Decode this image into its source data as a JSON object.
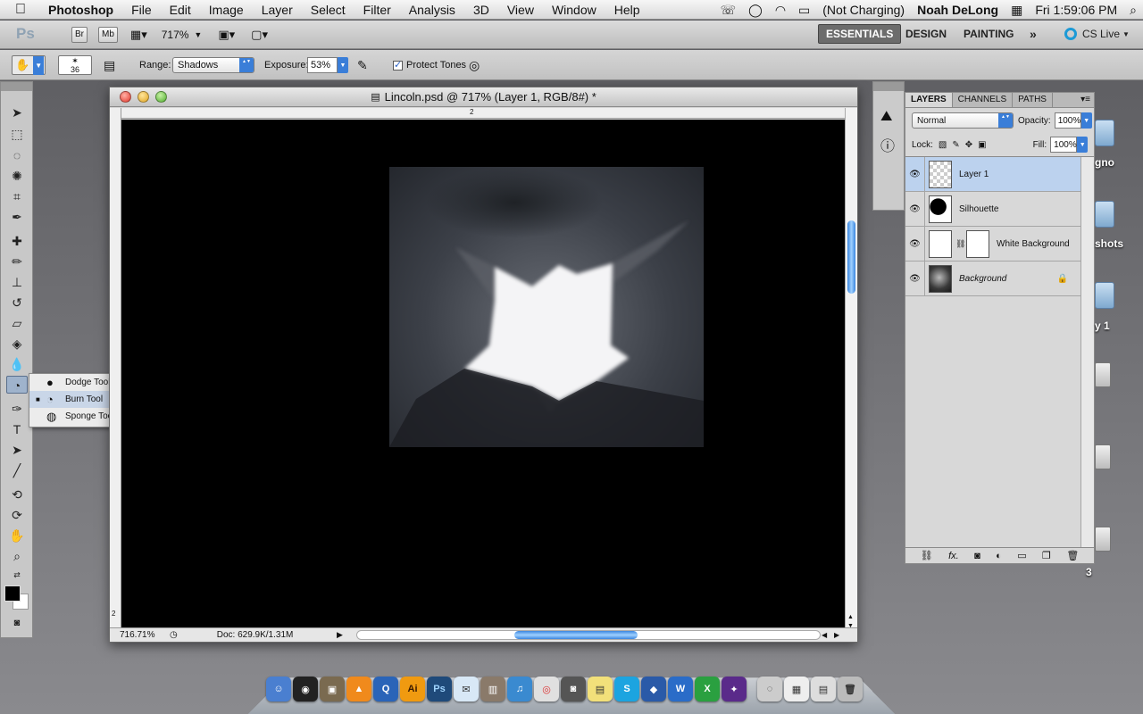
{
  "menubar": {
    "apple": "",
    "app_name": "Photoshop",
    "menus": [
      "File",
      "Edit",
      "Image",
      "Layer",
      "Select",
      "Filter",
      "Analysis",
      "3D",
      "View",
      "Window",
      "Help"
    ],
    "battery": "(Not Charging)",
    "user": "Noah DeLong",
    "clock": "Fri 1:59:06 PM"
  },
  "appbar": {
    "logo": "Ps",
    "bridge_label": "Br",
    "minibridge_label": "Mb",
    "zoom": "717%",
    "workspaces": [
      "ESSENTIALS",
      "DESIGN",
      "PAINTING"
    ],
    "active_workspace": "ESSENTIALS",
    "more": "»",
    "cs_live": "CS Live"
  },
  "options": {
    "brush_size": "36",
    "range_label": "Range:",
    "range_value": "Shadows",
    "exposure_label": "Exposure:",
    "exposure_value": "53%",
    "protect_tones_label": "Protect Tones",
    "protect_tones_checked": true
  },
  "flyout": {
    "items": [
      {
        "label": "Dodge Tool",
        "key": "O",
        "selected": false
      },
      {
        "label": "Burn Tool",
        "key": "O",
        "selected": true
      },
      {
        "label": "Sponge Tool",
        "key": "O",
        "selected": false
      }
    ]
  },
  "document": {
    "title": "Lincoln.psd @ 717% (Layer 1, RGB/8#) *",
    "ruler_top_mark": "2",
    "ruler_left_mark": "2",
    "zoom_status": "716.71%",
    "doc_info": "Doc: 629.9K/1.31M"
  },
  "layers_panel": {
    "tabs": [
      "LAYERS",
      "CHANNELS",
      "PATHS"
    ],
    "blend_mode": "Normal",
    "opacity_label": "Opacity:",
    "opacity": "100%",
    "lock_label": "Lock:",
    "fill_label": "Fill:",
    "fill": "100%",
    "layers": [
      {
        "name": "Layer 1",
        "selected": true
      },
      {
        "name": "Silhouette",
        "selected": false
      },
      {
        "name": "White Background",
        "selected": false
      },
      {
        "name": "Background",
        "selected": false
      }
    ]
  },
  "desktop_labels": [
    "gno",
    "shots",
    "y 1",
    "3"
  ],
  "dock": {
    "items": [
      "Finder",
      "Dashboard",
      "iPhoto",
      "VLC",
      "QuickTime",
      "Ai",
      "Ps",
      "Mail",
      "Preview",
      "iTunes",
      "Chrome",
      "Photo Booth",
      "Stickies",
      "Skype",
      "Maps",
      "W",
      "X",
      "Space",
      "Disk",
      "Calendar",
      "Files",
      "Trash"
    ]
  },
  "colors": {
    "accent_blue": "#3a7ed8",
    "selected_layer": "#bcd2ee"
  }
}
